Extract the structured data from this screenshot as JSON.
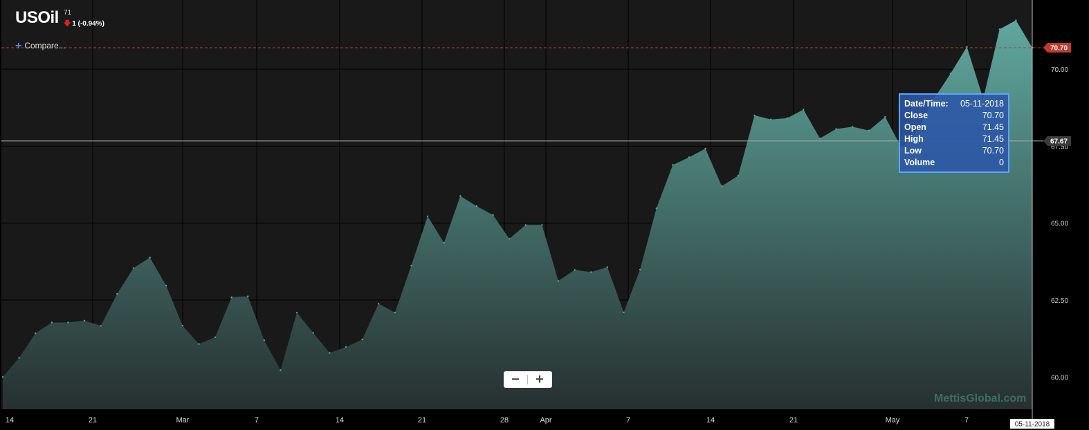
{
  "header": {
    "symbol": "USOil",
    "last": "71",
    "change": "1 (-0.94%)"
  },
  "compare_label": "Compare...",
  "zoom": {
    "minus": "−",
    "plus": "+"
  },
  "watermark": "MettisGlobal.com",
  "tooltip": {
    "date_label": "Date/Time:",
    "date": "05-11-2018",
    "close_label": "Close",
    "close": "70.70",
    "open_label": "Open",
    "open": "71.45",
    "high_label": "High",
    "high": "71.45",
    "low_label": "Low",
    "low": "70.70",
    "volume_label": "Volume",
    "volume": "0"
  },
  "colors": {
    "background": "#191919",
    "area_top": "#5fa89f",
    "area_bottom": "#26302f",
    "last_price_flag": "#c0392b",
    "crosshair_flag": "#3b3b3b",
    "grid": "#000000",
    "tooltip_border": "#5aa6ff"
  },
  "chart_data": {
    "type": "area",
    "x_tick_labels": [
      "14",
      "21",
      "Mar",
      "7",
      "14",
      "21",
      "28",
      "Apr",
      "7",
      "14",
      "21",
      "May",
      "7"
    ],
    "x_date_flag": "05-11-2018",
    "y_tick_labels": [
      "60.00",
      "62.50",
      "65.00",
      "67.50",
      "70.00"
    ],
    "ylim": [
      58.95,
      72.25
    ],
    "last_price_label": "70.70",
    "last_price": 70.7,
    "crosshair_label": "67.67",
    "crosshair_value": 67.67,
    "grid": true,
    "legend": "none",
    "series": [
      {
        "values": [
          60.0,
          60.62,
          61.42,
          61.77,
          61.77,
          61.83,
          61.66,
          62.7,
          63.54,
          63.88,
          62.97,
          61.67,
          61.07,
          61.29,
          62.59,
          62.62,
          61.19,
          60.22,
          62.09,
          61.43,
          60.78,
          60.97,
          61.22,
          62.38,
          62.09,
          63.62,
          65.22,
          64.36,
          65.88,
          65.55,
          65.26,
          64.49,
          64.94,
          64.94,
          63.12,
          63.48,
          63.41,
          63.57,
          62.1,
          63.49,
          65.48,
          66.89,
          67.14,
          67.42,
          66.2,
          66.54,
          68.5,
          68.37,
          68.41,
          68.69,
          67.75,
          68.06,
          68.13,
          68.01,
          68.45,
          67.45,
          68.03,
          69.05,
          69.86,
          70.73,
          69.04,
          71.3,
          71.59,
          70.7
        ]
      }
    ]
  }
}
